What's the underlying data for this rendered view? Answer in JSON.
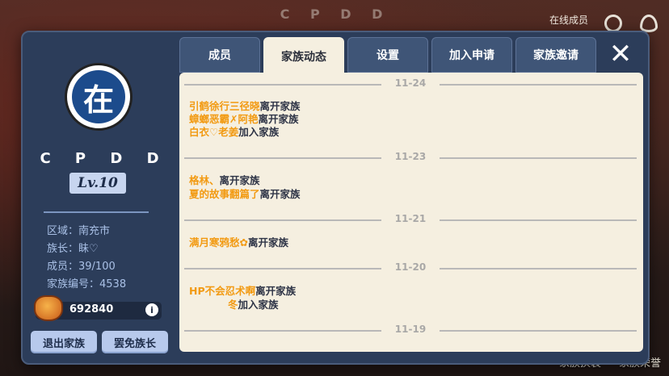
{
  "background": {
    "title": "C P D D",
    "online_label": "在线成员",
    "bottom_buttons": [
      "家族换装",
      "家族荣誉"
    ]
  },
  "family": {
    "emblem_char": "在",
    "name": "C P D D",
    "level": "Lv.10",
    "info": {
      "region": "区域：南充市",
      "leader": "族长：眛♡",
      "members": "成员：39/100",
      "family_id": "家族编号：4538"
    },
    "coins": "692840",
    "quit_label": "退出家族",
    "impeach_label": "罢免族长"
  },
  "tabs": [
    {
      "label": "成员",
      "active": false
    },
    {
      "label": "家族动态",
      "active": true
    },
    {
      "label": "设置",
      "active": false
    },
    {
      "label": "加入申请",
      "active": false
    },
    {
      "label": "家族邀请",
      "active": false
    }
  ],
  "close_label": "✕",
  "feed": [
    {
      "date": "11-24",
      "entries": [
        {
          "name": "引鹤徐行三径晓",
          "action": "离开家族"
        },
        {
          "name": "蟑螂恶霸✗阿艳",
          "action": "离开家族"
        },
        {
          "name": "白衣♡老姜",
          "action": "加入家族"
        }
      ]
    },
    {
      "date": "11-23",
      "entries": [
        {
          "name": "格林、",
          "action": "离开家族"
        },
        {
          "name": "夏的故事翻篇了",
          "action": "离开家族"
        }
      ]
    },
    {
      "date": "11-21",
      "entries": [
        {
          "name": "满月寒鸦愁✿",
          "action": "离开家族"
        }
      ]
    },
    {
      "date": "11-20",
      "entries": [
        {
          "name": "HP不会忍术啊",
          "action": "离开家族"
        },
        {
          "name": "冬",
          "action": "加入家族"
        }
      ]
    },
    {
      "date": "11-19",
      "entries": []
    }
  ]
}
